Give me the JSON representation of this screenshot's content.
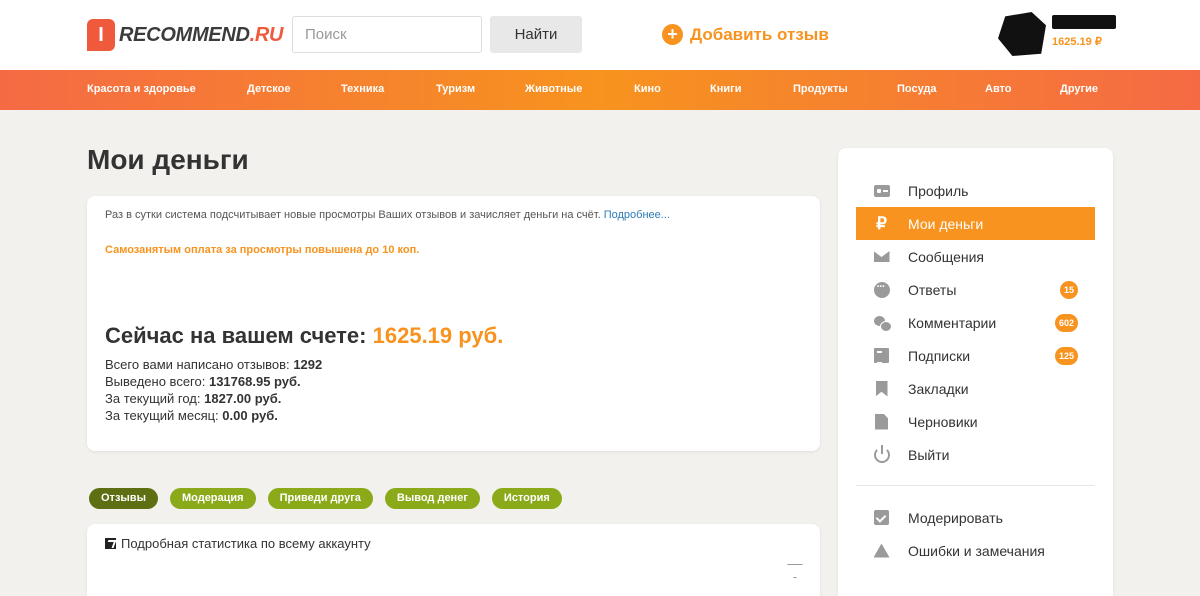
{
  "header": {
    "logo_mark": "I",
    "logo_main": "RECOMMEND",
    "logo_tld": ".RU",
    "search_placeholder": "Поиск",
    "search_button": "Найти",
    "add_review": "Добавить отзыв",
    "balance": "1625.19 ₽"
  },
  "nav": {
    "items": [
      "Красота и здоровье",
      "Детское",
      "Техника",
      "Туризм",
      "Животные",
      "Кино",
      "Книги",
      "Продукты",
      "Посуда",
      "Авто",
      "Другие"
    ]
  },
  "main": {
    "title": "Мои деньги",
    "info_text": "Раз в сутки система подсчитывает новые просмотры Ваших отзывов и зачисляет деньги на счёт.",
    "info_link": "Подробнее...",
    "promo": "Самозанятым оплата за просмотры повышена до 10 коп.",
    "balance_label": "Сейчас на вашем счете:",
    "balance_amount": "1625.19 руб.",
    "stats": [
      {
        "label": "Всего вами написано отзывов:",
        "value": "1292"
      },
      {
        "label": "Выведено всего:",
        "value": "131768.95 руб."
      },
      {
        "label": "За текущий год:",
        "value": "1827.00 руб."
      },
      {
        "label": "За текущий месяц:",
        "value": "0.00 руб."
      }
    ],
    "tabs": [
      "Отзывы",
      "Модерация",
      "Приведи друга",
      "Вывод денег",
      "История"
    ],
    "active_tab": "Отзывы",
    "stats_title": "Подробная статистика по всему аккаунту"
  },
  "sidebar": {
    "items": [
      {
        "label": "Профиль",
        "icon": "profile-card-icon"
      },
      {
        "label": "Мои деньги",
        "icon": "ruble-icon",
        "active": true
      },
      {
        "label": "Сообщения",
        "icon": "envelope-icon"
      },
      {
        "label": "Ответы",
        "icon": "chat-bubble-icon",
        "badge": "15"
      },
      {
        "label": "Комментарии",
        "icon": "comments-icon",
        "badge": "602"
      },
      {
        "label": "Подписки",
        "icon": "newspaper-icon",
        "badge": "125"
      },
      {
        "label": "Закладки",
        "icon": "bookmark-icon"
      },
      {
        "label": "Черновики",
        "icon": "document-icon"
      },
      {
        "label": "Выйти",
        "icon": "power-icon"
      }
    ],
    "secondary": [
      {
        "label": "Модерировать",
        "icon": "check-icon"
      },
      {
        "label": "Ошибки и замечания",
        "icon": "warning-icon"
      }
    ]
  },
  "colors": {
    "accent": "#f7931e",
    "brand": "#f05a3c",
    "tab_green": "#8aaa1a",
    "tab_active": "#5d6f12",
    "background": "#f3f1ed"
  }
}
